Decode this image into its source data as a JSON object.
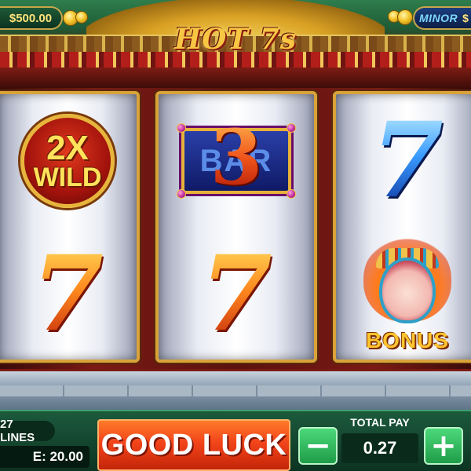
{
  "header": {
    "balance": "$500.00",
    "logo_text": "HOT 7s",
    "jackpot_minor_label": "MINOR",
    "jackpot_minor_value": "$"
  },
  "reels": [
    {
      "top": {
        "symbol": "wild",
        "multiplier": "2X",
        "label": "WILD"
      },
      "bottom": {
        "symbol": "seven",
        "glyph": "7",
        "color": "orange"
      }
    },
    {
      "top": {
        "symbol": "bar",
        "bar_label": "BAR",
        "number": "3"
      },
      "bottom": {
        "symbol": "seven",
        "glyph": "7",
        "color": "orange"
      }
    },
    {
      "top": {
        "symbol": "seven",
        "glyph": "7",
        "color": "blue"
      },
      "bottom": {
        "symbol": "bonus",
        "label": "BONUS"
      }
    }
  ],
  "controls": {
    "lines": "27 LINES",
    "bet": "E: 20.00",
    "spin_label": "GOOD LUCK",
    "minus_label": "−",
    "plus_label": "+",
    "total_pay_label": "TOTAL PAY",
    "total_pay_value": "0.27"
  },
  "colors": {
    "spin_button": "#f2441a",
    "reel_frame": "#d9a33a",
    "control_bar": "#1c5a3c",
    "stepper_button": "#2fb85c"
  },
  "icons": [
    "coin-icon",
    "minus-icon",
    "plus-icon"
  ]
}
